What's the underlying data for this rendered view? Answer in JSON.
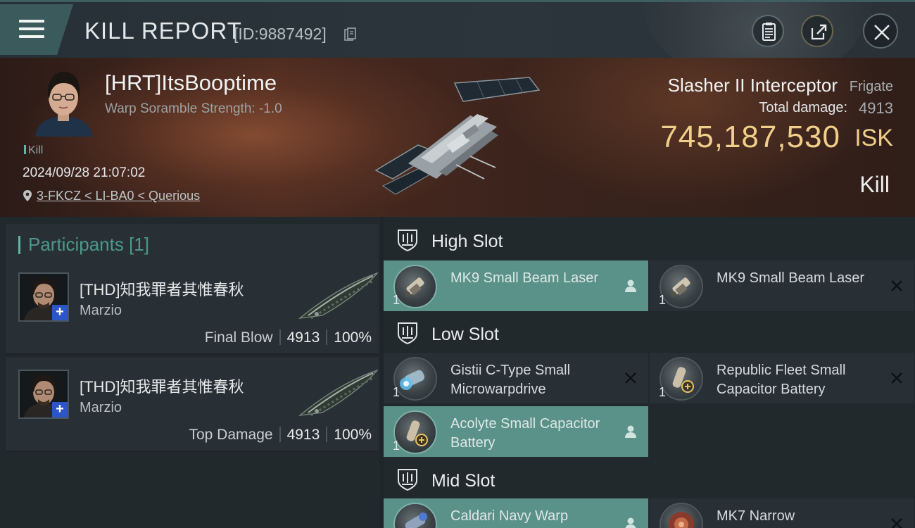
{
  "header": {
    "title": "KILL REPORT",
    "id_label": "[ID:9887492]"
  },
  "victim": {
    "name": "[HRT]ItsBooptime",
    "scramble": "Warp Soramble Strength: -1.0",
    "kill_tag": "Kill",
    "datetime": "2024/09/28 21:07:02",
    "location": "3-FKCZ < LI-BA0 < Querious"
  },
  "ship": {
    "name": "Slasher II Interceptor",
    "class": "Frigate",
    "damage_label": "Total damage:",
    "damage_value": "4913",
    "isk_value": "745,187,530",
    "isk_unit": "ISK",
    "result": "Kill"
  },
  "participants": {
    "label": "Participants [1]",
    "items": [
      {
        "name": "[THD]知我罪者其惟春秋",
        "pilot": "Marzio",
        "role": "Final Blow",
        "damage": "4913",
        "percent": "100%"
      },
      {
        "name": "[THD]知我罪者其惟春秋",
        "pilot": "Marzio",
        "role": "Top Damage",
        "damage": "4913",
        "percent": "100%"
      }
    ]
  },
  "fitting": {
    "high_slot": "High Slot",
    "low_slot": "Low Slot",
    "mid_slot": "Mid Slot",
    "modules": [
      {
        "name": "MK9 Small Beam Laser",
        "qty": "1",
        "status": "pilot-icon"
      },
      {
        "name": "MK9 Small Beam Laser",
        "qty": "1",
        "status": "destroyed-icon"
      },
      {
        "name": "Gistii C-Type Small Microwarpdrive",
        "qty": "1",
        "status": "destroyed-icon"
      },
      {
        "name": "Republic Fleet Small Capacitor Battery",
        "qty": "1",
        "status": "destroyed-icon"
      },
      {
        "name": "Acolyte Small Capacitor Battery",
        "qty": "1",
        "status": "pilot-icon"
      },
      {
        "name": "Caldari Navy Warp",
        "qty": "1",
        "status": "pilot-icon"
      },
      {
        "name": "MK7 Narrow",
        "qty": "1",
        "status": "destroyed-icon"
      }
    ]
  },
  "colors": {
    "accent": "#5fb6a8",
    "isk": "#f0cf8a",
    "highlight_module": "#5a9188"
  }
}
